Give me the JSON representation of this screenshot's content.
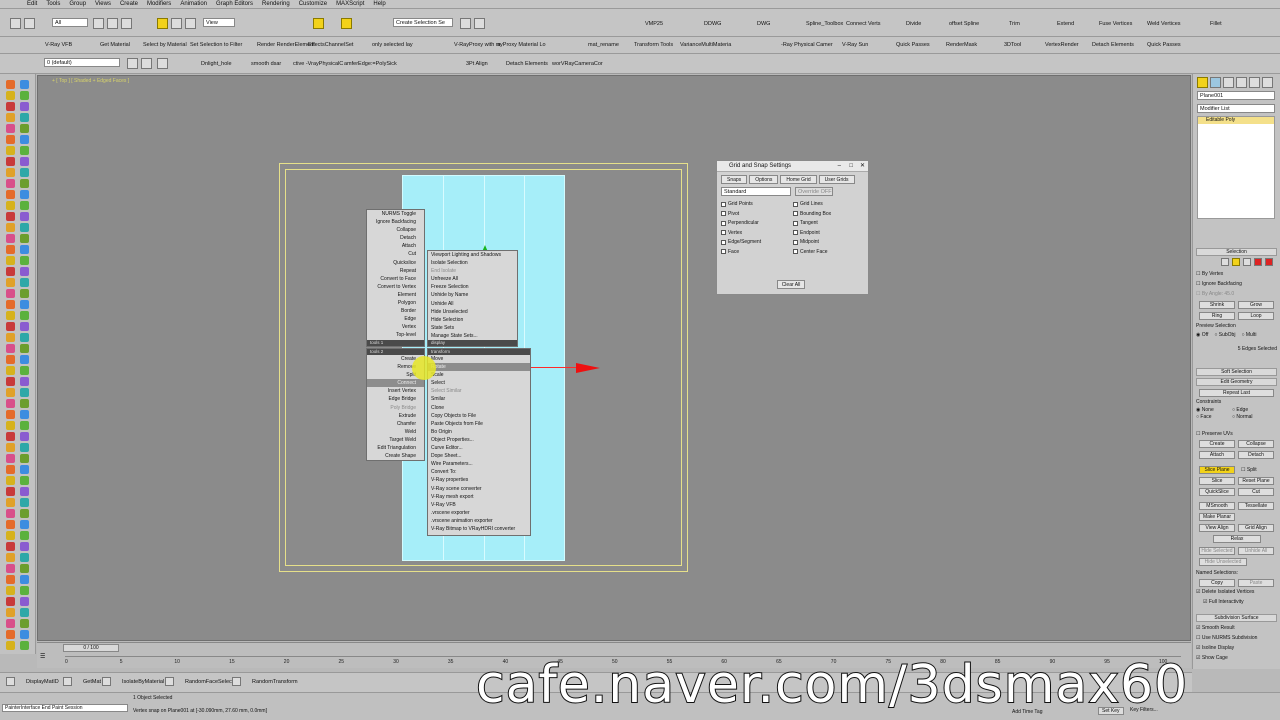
{
  "menubar": [
    "Edit",
    "Tools",
    "Group",
    "Views",
    "Create",
    "Modifiers",
    "Animation",
    "Graph Editors",
    "Rendering",
    "Customize",
    "MAXScript",
    "Help"
  ],
  "toolbar1": {
    "filter": "All",
    "view": "View",
    "selection_set": "Create Selection Se",
    "items": [
      "VMP25",
      "DDWG",
      "DWG",
      "Spline_Toolbox",
      "Connect Verts",
      "Divide",
      "offset Spline",
      "Trim",
      "Extend",
      "Fuse Vertices",
      "Weld Vertices",
      "Fillet"
    ]
  },
  "toolbar2": [
    "V-Ray VFB",
    "Get Material",
    "Select by Material",
    "Set Selection to Filter",
    "Render RenderElement",
    "EffectsChannelSet",
    "only selected lay",
    "V-RayProxy with m",
    "ayProxy Material Lo",
    "mat_rename",
    "Transform Tools",
    "VarianceMultiMateria",
    "-Ray Physical Camer",
    "V-Ray Sun",
    "Quick Passes",
    "RenderMask",
    "3DTool",
    "VertexRender",
    "Detach Elements",
    "Quick Passes"
  ],
  "toolbar3": {
    "layer": "0 (default)",
    "items": [
      "Dnlight_hole",
      "smooth dsar",
      "ctive -VrayPhysicalC",
      "amferEdge:=PolySick",
      "3Pt Align",
      "Detach Elements",
      "worVRayCameraCor"
    ]
  },
  "viewport": {
    "label": "+ [ Top ] [ Shaded + Edged Faces ]"
  },
  "quad_top": {
    "left": [
      {
        "t": "NURMS Toggle"
      },
      {
        "t": "Ignore Backfacing"
      },
      {
        "t": "Collapse"
      },
      {
        "t": "Detach"
      },
      {
        "t": "Attach"
      },
      {
        "t": "Cut"
      },
      {
        "t": "Quickslice"
      },
      {
        "t": "Repeat"
      },
      {
        "t": "Convert to Face"
      },
      {
        "t": "Convert to Vertex"
      },
      {
        "t": "Element"
      },
      {
        "t": "Polygon"
      },
      {
        "t": "Border"
      },
      {
        "t": "Edge"
      },
      {
        "t": "Vertex"
      },
      {
        "t": "Top-level"
      }
    ],
    "left_header": "tools 1",
    "right": [
      {
        "t": "Viewport Lighting and Shadows"
      },
      {
        "t": "Isolate Selection"
      },
      {
        "t": "End Isolate"
      },
      {
        "t": "Unfreeze All"
      },
      {
        "t": "Freeze Selection"
      },
      {
        "t": "Unhide by Name"
      },
      {
        "t": "Unhide All"
      },
      {
        "t": "Hide Unselected"
      },
      {
        "t": "Hide Selection"
      },
      {
        "t": "State Sets"
      },
      {
        "t": "Manage State Sets..."
      }
    ],
    "right_header": "display"
  },
  "quad_bottom": {
    "left_header": "tools 2",
    "left": [
      {
        "t": "Create"
      },
      {
        "t": "Remove"
      },
      {
        "t": "Split"
      },
      {
        "t": "Connect"
      },
      {
        "t": "Insert Vertex"
      },
      {
        "t": "Edge Bridge"
      },
      {
        "t": "Poly Bridge"
      },
      {
        "t": "Extrude"
      },
      {
        "t": "Chamfer"
      },
      {
        "t": "Weld"
      },
      {
        "t": "Target Weld"
      },
      {
        "t": "Edit Triangulation"
      },
      {
        "t": "Create Shape"
      }
    ],
    "right_header": "transform",
    "right": [
      {
        "t": "Move"
      },
      {
        "t": "Rotate"
      },
      {
        "t": "Scale"
      },
      {
        "t": "Select"
      },
      {
        "t": "Select Similar"
      },
      {
        "t": "Smilar"
      },
      {
        "t": "Clone"
      },
      {
        "t": "Copy Objects to File"
      },
      {
        "t": "Paste Objects from File"
      },
      {
        "t": "Bo Origin"
      },
      {
        "t": "Object Properties..."
      },
      {
        "t": "Curve Editor..."
      },
      {
        "t": "Dope Sheet..."
      },
      {
        "t": "Wire Parameters..."
      },
      {
        "t": "Convert To:"
      },
      {
        "t": "V-Ray properties"
      },
      {
        "t": "V-Ray scene converter"
      },
      {
        "t": "V-Ray mesh export"
      },
      {
        "t": "V-Ray VFB"
      },
      {
        "t": ".vrscene exporter"
      },
      {
        "t": ".vrscene animation exporter"
      },
      {
        "t": "V-Ray Bitmap to VRayHDRI converter"
      }
    ]
  },
  "grid_dialog": {
    "title": "Grid and Snap Settings",
    "tabs": [
      "Snaps",
      "Options",
      "Home Grid",
      "User Grids"
    ],
    "dropdown": "Standard",
    "override": "Override OFF",
    "snaps_left": [
      "Grid Points",
      "Pivot",
      "Perpendicular",
      "Vertex",
      "Edge/Segment",
      "Face"
    ],
    "snaps_right": [
      "Grid Lines",
      "Bounding Box",
      "Tangent",
      "Endpoint",
      "Midpoint",
      "Center Face"
    ],
    "clear_all": "Clear All"
  },
  "command_panel": {
    "object_name": "Plane001",
    "modifier_list": "Modifier List",
    "modifier_item": "Editable Poly",
    "selection_title": "Selection",
    "by_vertex": "By Vertex",
    "ignore_backfacing": "Ignore Backfacing",
    "by_angle": "By Angle:",
    "angle_value": "45.0",
    "shrink": "Shrink",
    "grow": "Grow",
    "ring": "Ring",
    "loop": "Loop",
    "preview_selection": "Preview Selection",
    "preview_opts": [
      "Off",
      "SubObj",
      "Multi"
    ],
    "edges_selected": "5 Edges Selected",
    "soft_selection": "Soft Selection",
    "edit_geometry": "Edit Geometry",
    "repeat_last": "Repeat Last",
    "constraints": "Constraints",
    "constraint_opts": [
      "None",
      "Edge",
      "Face",
      "Normal"
    ],
    "preserve_uvs": "Preserve UVs",
    "create": "Create",
    "collapse": "Collapse",
    "attach": "Attach",
    "detach": "Detach",
    "slice_plane": "Slice Plane",
    "split": "Split",
    "slice": "Slice",
    "reset_plane": "Reset Plane",
    "quickslice": "QuickSlice",
    "cut": "Cut",
    "msmooth": "MSmooth",
    "tessellate": "Tessellate",
    "make_planar": "Make Planar",
    "view_align": "View Align",
    "grid_align": "Grid Align",
    "relax": "Relax",
    "hide_selected": "Hide Selected",
    "unhide_all": "Unhide All",
    "hide_unselected": "Hide Unselected",
    "named_selections": "Named Selections:",
    "copy": "Copy",
    "paste": "Paste",
    "delete_isolated": "Delete Isolated Vertices",
    "full_interactivity": "Full Interactivity",
    "subdivision_surface": "Subdivision Surface",
    "smooth_result": "Smooth Result",
    "use_nurms": "Use NURMS Subdivision",
    "isoline_display": "Isoline Display",
    "show_cage": "Show Cage"
  },
  "timeline": {
    "frame": "0 / 100",
    "ticks": [
      "0",
      "5",
      "10",
      "15",
      "20",
      "25",
      "30",
      "35",
      "40",
      "45",
      "50",
      "55",
      "60",
      "65",
      "70",
      "75",
      "80",
      "85",
      "90",
      "95",
      "100"
    ]
  },
  "bottom_tools": [
    "DisplayMatID",
    "GetMat",
    "IsolateByMaterial",
    "RandomFaceSelect",
    "RandomTransform"
  ],
  "status": {
    "script": "PainterInterface End Paint Session",
    "selected": "1 Object Selected",
    "prompt": "Vertex snap on Plane001 at [-30.090mm, 27.60 mm, 0.0mm]",
    "add_time_tag": "Add Time Tag",
    "set_key": "Set Key",
    "key_filters": "Key Filters..."
  },
  "watermark": "cafe.naver.com/3dsmax60"
}
